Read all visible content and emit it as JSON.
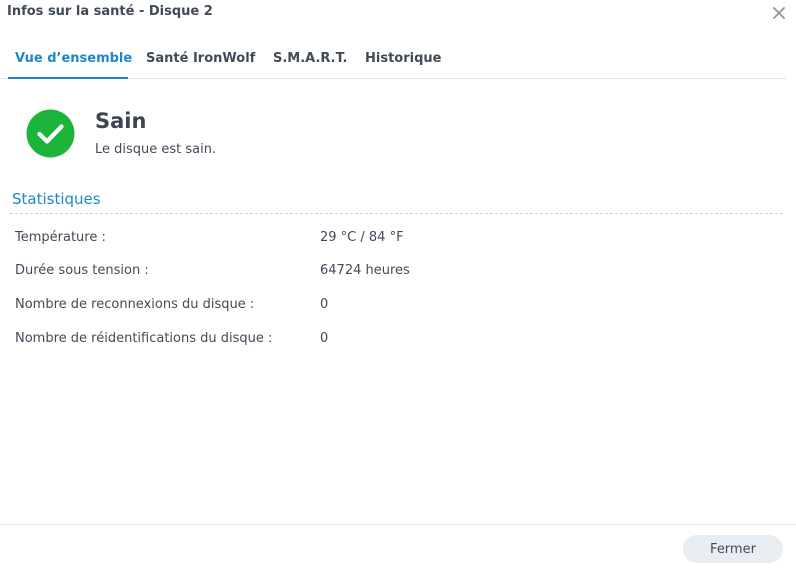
{
  "window": {
    "title": "Infos sur la santé - Disque 2",
    "close_icon": "close-icon"
  },
  "tabs": [
    {
      "label": "Vue d’ensemble",
      "active": true
    },
    {
      "label": "Santé IronWolf",
      "active": false
    },
    {
      "label": "S.M.A.R.T.",
      "active": false
    },
    {
      "label": "Historique",
      "active": false
    }
  ],
  "status": {
    "icon": "check-circle-icon",
    "title": "Sain",
    "description": "Le disque est sain."
  },
  "statistics": {
    "title": "Statistiques",
    "rows": [
      {
        "label": "Température :",
        "value": "29 °C / 84 °F"
      },
      {
        "label": "Durée sous tension :",
        "value": "64724 heures"
      },
      {
        "label": "Nombre de reconnexions du disque :",
        "value": "0"
      },
      {
        "label": "Nombre de réidentifications du disque :",
        "value": "0"
      }
    ]
  },
  "footer": {
    "close_label": "Fermer"
  },
  "colors": {
    "accent": "#1f87c8",
    "success": "#1db43b",
    "text": "#414b58"
  }
}
